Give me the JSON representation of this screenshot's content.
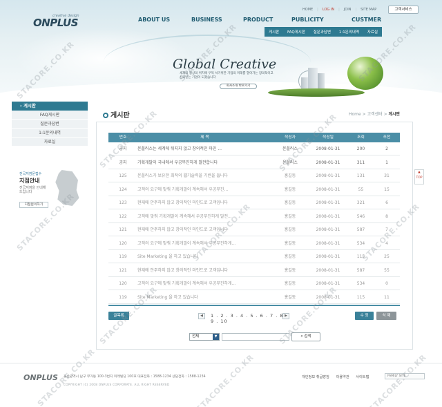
{
  "header": {
    "logo_text": "ONPLUS",
    "logo_sub": "creative design",
    "top_links": [
      "HOME",
      "LOG IN",
      "JOIN",
      "SITE MAP"
    ],
    "service_button": "고객서비스",
    "gnb": [
      "ABOUT US",
      "BUSINESS",
      "PRODUCT",
      "PUBLICITY",
      "CUSTMER"
    ],
    "subnav": [
      "게시판",
      "FAQ게시판",
      "질문과답변",
      "1:1문의내역",
      "자료실"
    ],
    "slogan": "Global Creative",
    "slogan_sub": "세계의 정상의 위치에 우뚝 서기위한 기업의 미래를 열어가는 창의적이고 신뢰받는 기업이 되겠습니다",
    "hero_button": "회사소개 바로가기"
  },
  "sidebar": {
    "head": "게시판",
    "items": [
      "FAQ게시판",
      "질문과답변",
      "1:1문의내역",
      "자료실"
    ],
    "cs_small": "전국지점문접수",
    "cs_title": "지점안내",
    "cs_desc": "전국지점을 안내해드립니다",
    "cs_button": "지점문의하기"
  },
  "main": {
    "title": "게시판",
    "breadcrumb": [
      "Home",
      "고객센터"
    ],
    "breadcrumb_current": "게시판",
    "columns": [
      "번호",
      "제 목",
      "작성자",
      "작성일",
      "조회",
      "추천"
    ],
    "rows": [
      {
        "no": "공지",
        "subject": "온플러스는 세계에 뒤지지 않고 창의적인 마인 ...",
        "author": "온플러스",
        "date": "2008-01-31",
        "views": "200",
        "rec": "2",
        "notice": true
      },
      {
        "no": "공지",
        "subject": "기획개발이 국내에서 우공무진하게 발전합니다",
        "author": "온플러스",
        "date": "2008-01-31",
        "views": "311",
        "rec": "1",
        "notice": true
      },
      {
        "no": "125",
        "subject": "온플러스가 보유한 최적의 웹기술력을 기반을 둡니다",
        "author": "홍길동",
        "date": "2008-01-31",
        "views": "131",
        "rec": "31",
        "notice": false
      },
      {
        "no": "124",
        "subject": "고객의 요구에 맞춰 기획개발이 계속해서 우공무진...",
        "author": "홍길동",
        "date": "2008-01-31",
        "views": "55",
        "rec": "15",
        "notice": false
      },
      {
        "no": "123",
        "subject": "현재에 안주하지 않고 창의적인 마인드로 고객입니다",
        "author": "홍길동",
        "date": "2008-01-31",
        "views": "321",
        "rec": "6",
        "notice": false
      },
      {
        "no": "122",
        "subject": "고객에 맞춰 기획개발이 계속해서 우공무진하게 발전...",
        "author": "홍길동",
        "date": "2008-01-31",
        "views": "546",
        "rec": "8",
        "notice": false
      },
      {
        "no": "121",
        "subject": "현재에 안주하지 않고 창의적인 마인드로 고객입니다",
        "author": "홍길동",
        "date": "2008-01-31",
        "views": "587",
        "rec": "7",
        "notice": false
      },
      {
        "no": "120",
        "subject": "고객의 요구에 맞춰 기획개발이 계속해서 우공무진하게...",
        "author": "홍길동",
        "date": "2008-01-31",
        "views": "534",
        "rec": "4",
        "notice": false
      },
      {
        "no": "119",
        "subject": "Site Marketing 을 하고 있습니다",
        "author": "홍길동",
        "date": "2008-01-31",
        "views": "115",
        "rec": "25",
        "notice": false
      },
      {
        "no": "121",
        "subject": "현재에 안주하지 않고 창의적인 마인드로 고객입니다",
        "author": "홍길동",
        "date": "2008-01-31",
        "views": "587",
        "rec": "55",
        "notice": false
      },
      {
        "no": "120",
        "subject": "고객의 요구에 맞춰 기획개발이 계속해서 우공무진하게...",
        "author": "홍길동",
        "date": "2008-01-31",
        "views": "534",
        "rec": "0",
        "notice": false
      },
      {
        "no": "119",
        "subject": "Site Marketing 을 하고 있습니다",
        "author": "홍길동",
        "date": "2008-01-31",
        "views": "115",
        "rec": "11",
        "notice": false
      }
    ],
    "list_button": "글목록",
    "pages": "1 . 2 . 3 . 4 . 5 . 6 . 7 . 8 . 9 . 10",
    "write_button": "수 정",
    "delete_button": "삭 제",
    "search_select": "전체",
    "search_button": "검색"
  },
  "top_button": "TOP",
  "footer": {
    "logo": "ONPLUS",
    "address": "울산광역시 남구 무거동 100-3번지 미래빌딩 100호   대표전화 : 1588-1234   상담전화 : 1588-1234",
    "copyright": "COPYRIGHT (C) 2008 ONPLUS CORPORATE. ALL RIGHT RESERVED",
    "links": [
      "개인정보 취급방침",
      "이용약관",
      "사이트맵"
    ],
    "family_site": "FAMILY SITE"
  },
  "watermark": "STACORE.CO.KR"
}
